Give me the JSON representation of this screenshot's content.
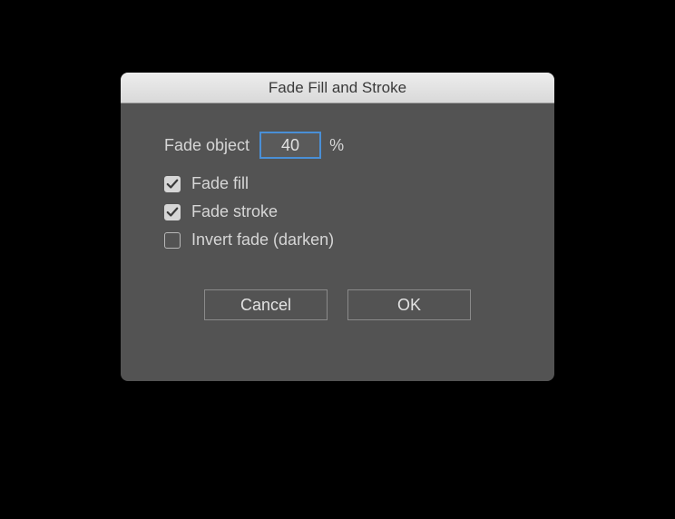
{
  "dialog": {
    "title": "Fade Fill and Stroke",
    "fade_object_label": "Fade object",
    "fade_object_value": "40",
    "percent_symbol": "%",
    "options": {
      "fade_fill": {
        "label": "Fade fill",
        "checked": true
      },
      "fade_stroke": {
        "label": "Fade stroke",
        "checked": true
      },
      "invert_fade": {
        "label": "Invert fade (darken)",
        "checked": false
      }
    },
    "buttons": {
      "cancel": "Cancel",
      "ok": "OK"
    }
  }
}
